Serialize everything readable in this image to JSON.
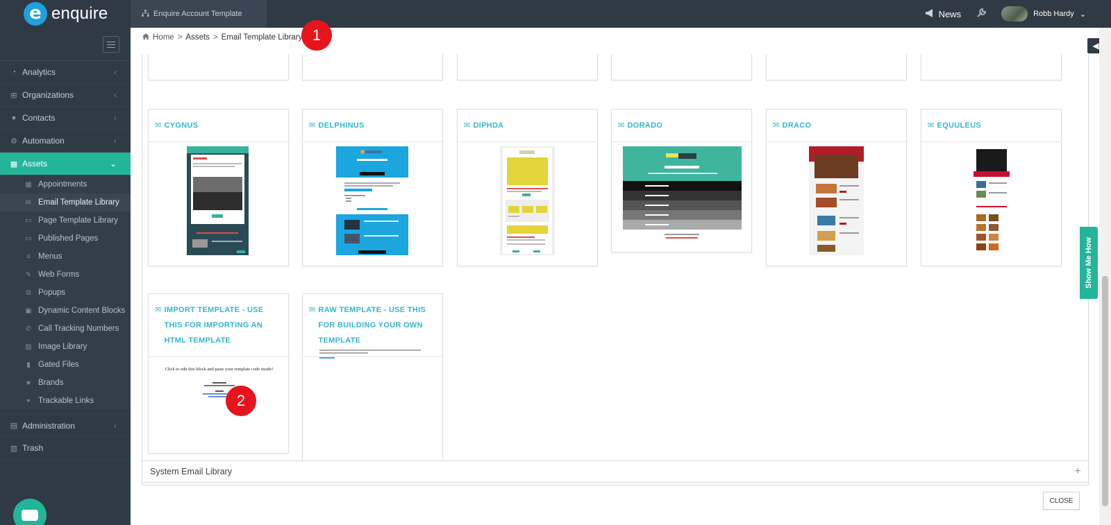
{
  "header": {
    "logo_text": "enquire",
    "logo_mark": "e",
    "account_tab": "Enquire Account Template",
    "news_label": "News",
    "user_name": "Robb Hardy",
    "icons": {
      "account": "sitemap-icon",
      "news": "megaphone-icon",
      "tools": "wrench-icon",
      "user_menu": "chevron-down-icon"
    }
  },
  "sidebar": {
    "items": [
      {
        "label": "Analytics",
        "icon": "dashboard-icon"
      },
      {
        "label": "Organizations",
        "icon": "sitemap-icon"
      },
      {
        "label": "Contacts",
        "icon": "users-icon"
      },
      {
        "label": "Automation",
        "icon": "cogs-icon"
      },
      {
        "label": "Assets",
        "icon": "grid-icon"
      }
    ],
    "assets_sub": [
      "Appointments",
      "Email Template Library",
      "Page Template Library",
      "Published Pages",
      "Menus",
      "Web Forms",
      "Popups",
      "Dynamic Content Blocks",
      "Call Tracking Numbers",
      "Image Library",
      "Gated Files",
      "Brands",
      "Trackable Links"
    ],
    "bottom_items": [
      {
        "label": "Administration",
        "icon": "lock-icon"
      },
      {
        "label": "Trash",
        "icon": "trash-icon"
      }
    ],
    "active_item": "Assets",
    "active_sub": "Email Template Library"
  },
  "breadcrumb": {
    "home": "Home",
    "assets": "Assets",
    "current": "Email Template Library"
  },
  "markers": [
    "1",
    "2"
  ],
  "templates": [
    {
      "name": "CYGNUS"
    },
    {
      "name": "DELPHINUS"
    },
    {
      "name": "DIPHDA"
    },
    {
      "name": "DORADO"
    },
    {
      "name": "DRACO"
    },
    {
      "name": "EQUULEUS"
    },
    {
      "name": "IMPORT TEMPLATE - USE THIS FOR IMPORTING AN HTML TEMPLATE"
    },
    {
      "name": "RAW TEMPLATE - USE THIS FOR BUILDING YOUR OWN TEMPLATE"
    }
  ],
  "import_thumb_text": "Click to edit this block and paste your template code inside!",
  "system_library": "System Email Library",
  "close_label": "CLOSE",
  "show_me_how": "Show Me How",
  "colors": {
    "sidebar": "#2f3a45",
    "accent": "#23b59a",
    "link": "#36b6c9",
    "marker": "#e8141c"
  }
}
